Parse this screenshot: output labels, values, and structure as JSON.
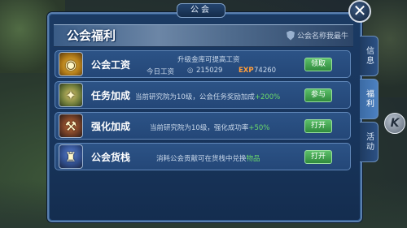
{
  "window": {
    "title": "公会",
    "close_label": "✕"
  },
  "banner": {
    "title": "公会福利",
    "right_text": "公会名称我最牛"
  },
  "side_tabs": [
    {
      "label": "信息",
      "active": false
    },
    {
      "label": "福利",
      "active": true
    },
    {
      "label": "活动",
      "active": false
    }
  ],
  "k_badge": "K",
  "rows": [
    {
      "name": "公会工资",
      "desc_line1": "升级金库可提高工资",
      "desc_label": "今日工资",
      "coin_value": "215029",
      "exp_label": "EXP",
      "exp_value": "74260",
      "button": "领取",
      "icon": "gold-coins-icon"
    },
    {
      "name": "任务加成",
      "desc_prefix": "当前研究院为10级，公会任务奖励加成",
      "desc_highlight": "+200%",
      "button": "参与",
      "icon": "quest-scroll-icon"
    },
    {
      "name": "强化加成",
      "desc_prefix": "当前研究院为10级，强化成功率",
      "desc_highlight": "+50%",
      "button": "打开",
      "icon": "forge-icon"
    },
    {
      "name": "公会货栈",
      "desc_prefix": "消耗公会贡献可在货栈中兑换",
      "desc_highlight": "物品",
      "button": "打开",
      "icon": "warehouse-icon"
    }
  ],
  "colors": {
    "accent_green": "#5cc06a",
    "highlight_text": "#6bd96b",
    "panel_blue": "#1b3a63"
  }
}
